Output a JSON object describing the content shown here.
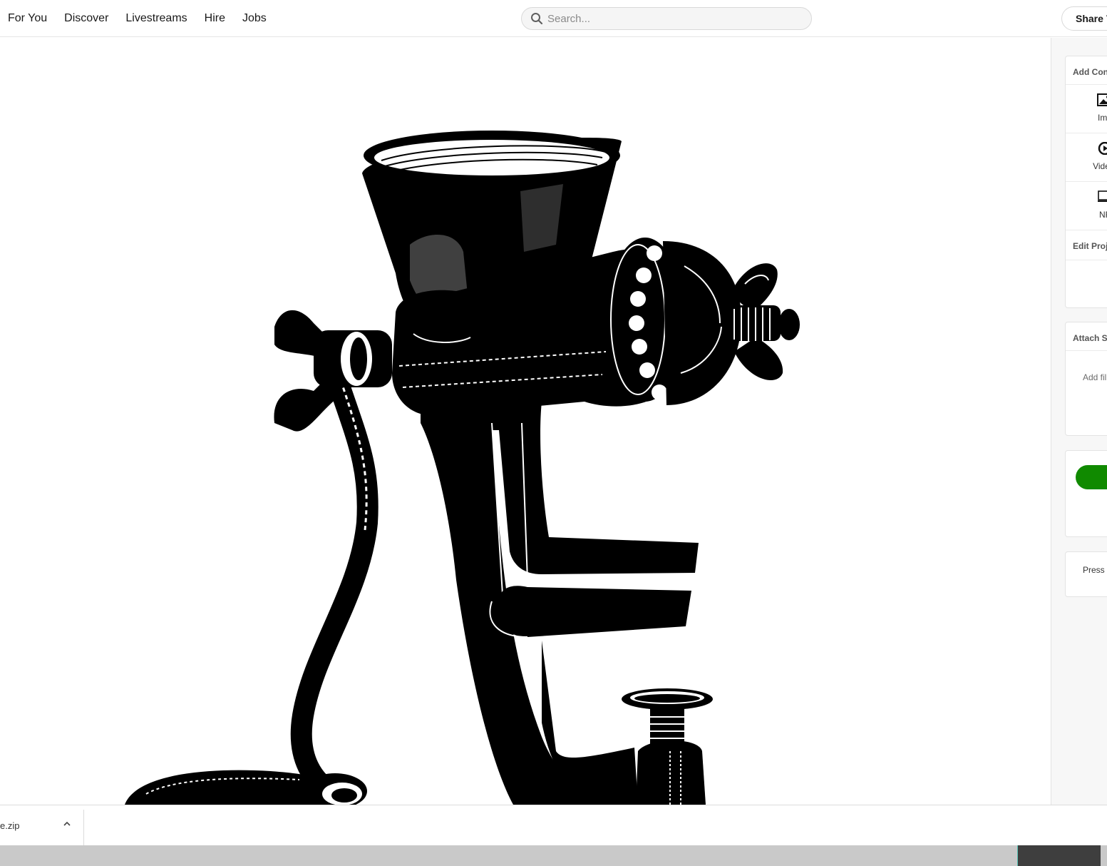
{
  "nav": {
    "items": [
      {
        "label": "For You"
      },
      {
        "label": "Discover"
      },
      {
        "label": "Livestreams"
      },
      {
        "label": "Hire"
      },
      {
        "label": "Jobs"
      }
    ]
  },
  "search": {
    "placeholder": "Search..."
  },
  "header": {
    "share_label": "Share Y"
  },
  "canvas": {
    "image_icon": "meat-grinder-illustration"
  },
  "panel": {
    "add_content": {
      "title": "Add Con",
      "tools": [
        {
          "label": "Ima",
          "icon": "image-icon"
        },
        {
          "label": "Video/",
          "icon": "play-icon"
        },
        {
          "label": "NF",
          "icon": "monitor-icon"
        }
      ]
    },
    "edit_project": {
      "title": "Edit Proj"
    },
    "attach": {
      "title": "Attach S",
      "add_files": "Add fil"
    },
    "continue": {
      "color": "#108a00"
    },
    "hint": "Press"
  },
  "downloads": {
    "file_name": "e.zip"
  }
}
